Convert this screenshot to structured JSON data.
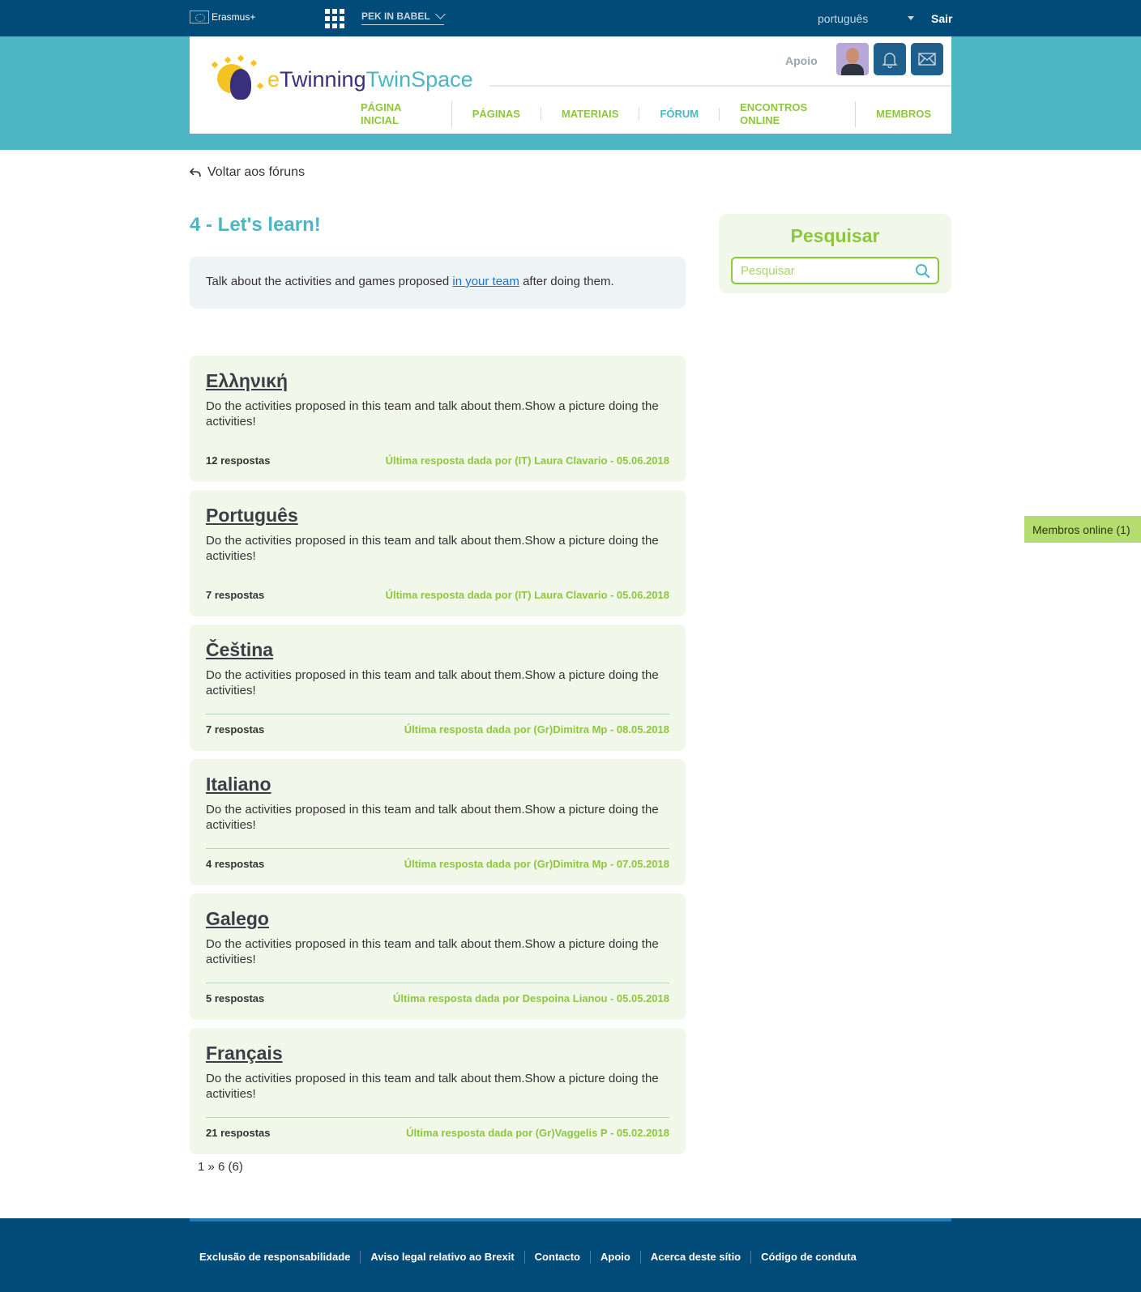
{
  "topbar": {
    "program": "Erasmus+",
    "project": "PEK IN BABEL",
    "language": "português",
    "logout": "Sair"
  },
  "header": {
    "logo_e": "e",
    "logo_twinning": "Twinning",
    "logo_twinspace": "TwinSpace",
    "support": "Apoio",
    "nav": [
      {
        "label": "PÁGINA INICIAL"
      },
      {
        "label": "PÁGINAS"
      },
      {
        "label": "MATERIAIS"
      },
      {
        "label": "FÓRUM"
      },
      {
        "label": "ENCONTROS ONLINE"
      },
      {
        "label": "MEMBROS"
      }
    ]
  },
  "content": {
    "back": "Voltar aos fóruns",
    "title": "4 - Let's learn!",
    "desc_before": "Talk about the activities and games proposed ",
    "desc_link": "in your team",
    "desc_after": " after doing them.",
    "topics": [
      {
        "title": "Ελληνική",
        "text": "Do the activities proposed in this team and talk about them.Show a picture doing the activities!",
        "replies": "12 respostas",
        "last": "Última resposta dada por (IT) Laura Clavario - 05.06.2018"
      },
      {
        "title": "Português",
        "text": "Do the activities proposed in this team and talk about them.Show a picture doing the activities!",
        "replies": "7 respostas",
        "last": "Última resposta dada por (IT) Laura Clavario - 05.06.2018"
      },
      {
        "title": "Čeština",
        "text": "Do the activities proposed in this team and talk about them.Show a picture doing the activities!",
        "replies": "7 respostas",
        "last": "Última resposta dada por (Gr)Dimitra Mp - 08.05.2018"
      },
      {
        "title": "Italiano",
        "text": "Do the activities proposed in this team and talk about them.Show a picture doing the activities!",
        "replies": "4 respostas",
        "last": "Última resposta dada por (Gr)Dimitra Mp - 07.05.2018"
      },
      {
        "title": "Galego",
        "text": "Do the activities proposed in this team and talk about them.Show a picture doing the activities!",
        "replies": "5 respostas",
        "last": "Última resposta dada por Despoina Lianou - 05.05.2018"
      },
      {
        "title": "Français",
        "text": "Do the activities proposed in this team and talk about them.Show a picture doing the activities!",
        "replies": "21 respostas",
        "last": "Última resposta dada por (Gr)Vaggelis P - 05.02.2018"
      }
    ],
    "pagination": "1 » 6 (6)"
  },
  "sidebar": {
    "search_title": "Pesquisar",
    "search_placeholder": "Pesquisar",
    "online": "Membros online (1)"
  },
  "footer": {
    "links": [
      {
        "label": "Exclusão de responsabilidade"
      },
      {
        "label": "Aviso legal relativo ao Brexit"
      },
      {
        "label": "Contacto"
      },
      {
        "label": "Apoio"
      },
      {
        "label": "Acerca deste sítio"
      },
      {
        "label": "Código de conduta"
      }
    ]
  },
  "colors": {
    "topbar": "#004b78",
    "band": "#4cb6c2",
    "accent_green": "#8dc63f",
    "card_bg": "#f1f8ea"
  },
  "icons": [
    "eu-flag-icon",
    "apps-grid-icon",
    "chevron-down-icon",
    "caret-down-icon",
    "bell-icon",
    "mail-icon",
    "back-arrow-icon",
    "search-icon"
  ]
}
